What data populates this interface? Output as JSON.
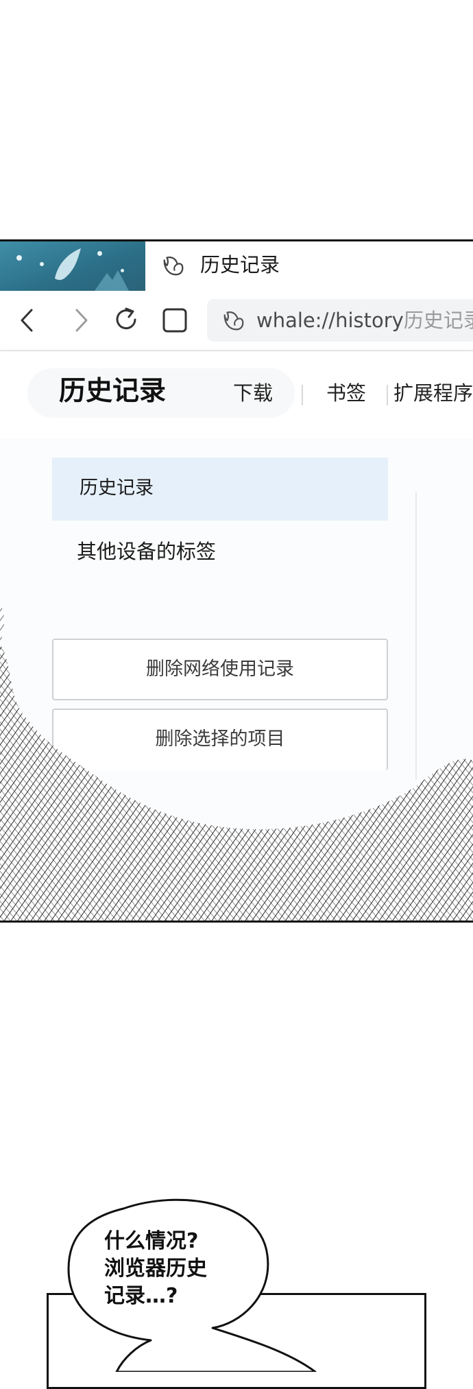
{
  "tab": {
    "title": "历史记录"
  },
  "address_bar": {
    "url": "whale://history",
    "page_name": "历史记录"
  },
  "header": {
    "title": "历史记录",
    "links": [
      "下载",
      "书签",
      "扩展程序"
    ]
  },
  "sidebar": {
    "items": [
      {
        "label": "历史记录",
        "active": true
      },
      {
        "label": "其他设备的标签",
        "active": false
      }
    ]
  },
  "actions": {
    "clear_browsing_data": "删除网络使用记录",
    "delete_selected": "删除选择的项目"
  },
  "speech_bubble": {
    "lines": [
      "什么情况?",
      "浏览器历史",
      "记录…?"
    ]
  },
  "colors": {
    "active_nav_bg": "#e6f0fa",
    "tab_art": "#2b6e86",
    "url_text": "#4a4a4a",
    "url_sub_text": "#9a9a9a"
  },
  "icons": [
    "whale-logo-icon",
    "back-arrow-icon",
    "forward-arrow-icon",
    "reload-icon",
    "tab-overview-icon"
  ]
}
